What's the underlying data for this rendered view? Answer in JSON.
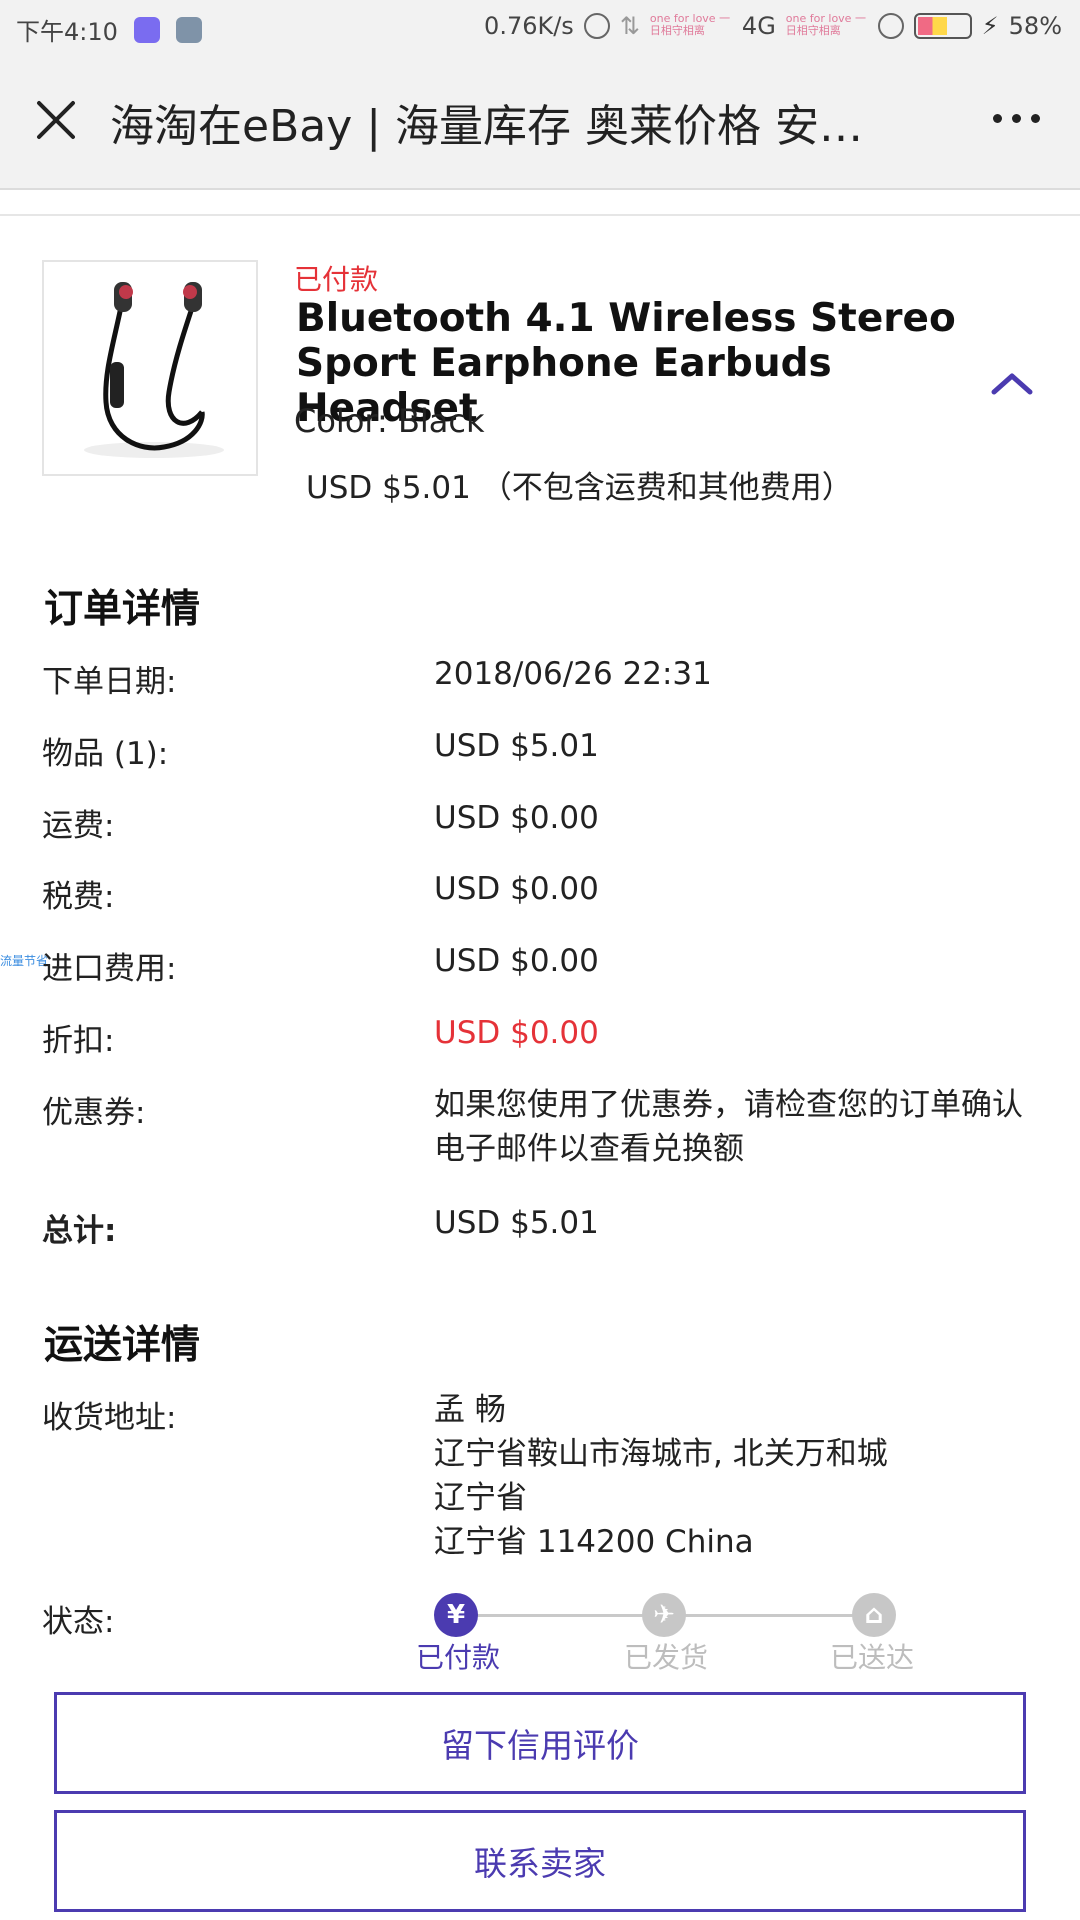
{
  "status_bar": {
    "time": "下午4:10",
    "speed": "0.76K/s",
    "network": "4G",
    "battery": "58%",
    "battery_level": 0.58,
    "carrier_text_1": "one for love 一日相守相离",
    "carrier_text_2": "one for love 一日相守相离"
  },
  "titlebar": {
    "title": "海淘在eBay | 海量库存 奥莱价格 安…"
  },
  "product": {
    "payment_status": "已付款",
    "title": "Bluetooth 4.1 Wireless Stereo Sport Earphone Earbuds Headset",
    "color": "Color: Black",
    "price": "USD $5.01 （不包含运费和其他费用）"
  },
  "order_details": {
    "heading": "订单详情",
    "rows": [
      {
        "label": "下单日期:",
        "value": "2018/06/26 22:31"
      },
      {
        "label": "物品 (1):",
        "value": "USD $5.01"
      },
      {
        "label": "运费:",
        "value": "USD $0.00"
      },
      {
        "label": "税费:",
        "value": "USD $0.00"
      },
      {
        "label": "进口费用:",
        "value": "USD $0.00"
      },
      {
        "label": "折扣:",
        "value": "USD $0.00"
      },
      {
        "label": "优惠券:",
        "value": "如果您使用了优惠券，请检查您的订单确认电子邮件以查看兑换额"
      },
      {
        "label": "总计:",
        "value": "USD $5.01"
      }
    ],
    "side_note": "流量节省"
  },
  "shipping": {
    "heading": "运送详情",
    "address_label": "收货地址:",
    "address_lines": [
      "孟 畅",
      "辽宁省鞍山市海城市, 北关万和城",
      "辽宁省",
      "辽宁省 114200 China"
    ],
    "status_label": "状态:",
    "steps": [
      {
        "label": "已付款",
        "icon": "yuan-icon",
        "glyph": "¥",
        "active": true
      },
      {
        "label": "已发货",
        "icon": "plane-icon",
        "glyph": "✈",
        "active": false
      },
      {
        "label": "已送达",
        "icon": "home-icon",
        "glyph": "⌂",
        "active": false
      }
    ]
  },
  "actions": {
    "feedback": "留下信用评价",
    "contact": "联系卖家"
  },
  "colors": {
    "accent": "#4b3bb0",
    "alert_red": "#e53238"
  }
}
